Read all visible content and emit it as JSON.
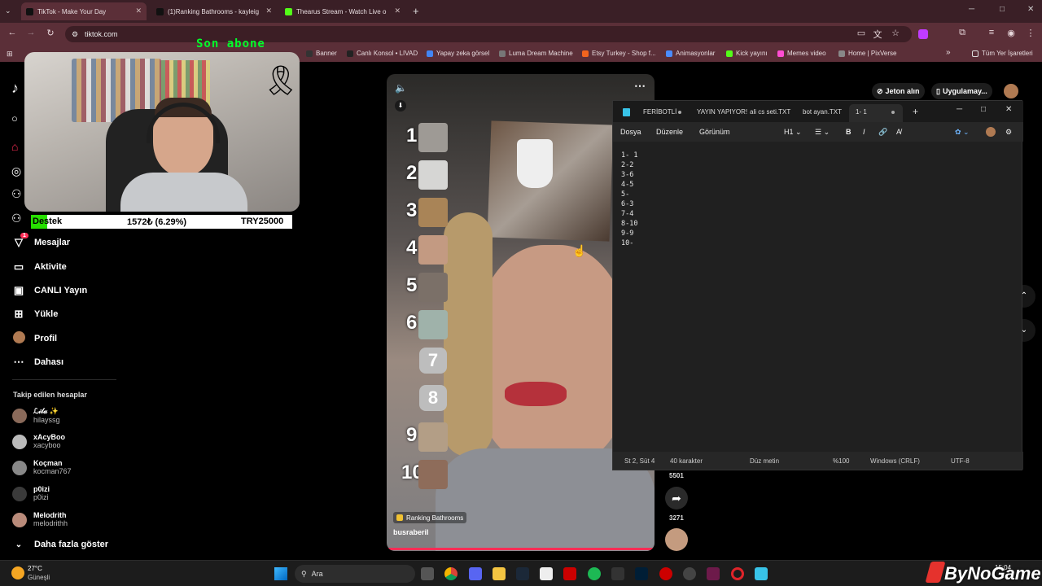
{
  "browser": {
    "tabs": [
      {
        "title": "TikTok - Make Your Day",
        "active": true
      },
      {
        "title": "(1)Ranking Bathrooms - kayleig",
        "active": false
      },
      {
        "title": "Thearus Stream - Watch Live o",
        "active": false
      }
    ],
    "new_tab": "+",
    "url": "tiktok.com",
    "bookmarks": [
      "Banner",
      "Canlı Konsol • LIVAD",
      "Yapay zeka görsel",
      "Luma Dream Machine",
      "Etsy Turkey - Shop f...",
      "Animasyonlar",
      "Kick yayını",
      "Memes video",
      "Home | PixVerse"
    ],
    "bookmarks_more": "»",
    "all_bookmarks": "Tüm Yer İşaretleri"
  },
  "stream_overlay": {
    "subscribe_text": "Son abone",
    "donation_label": "Destek",
    "donation_progress_text": "1572₺ (6.29%)",
    "donation_progress": 0.0629,
    "donation_goal": "TRY25000"
  },
  "tiktok": {
    "sidebar": {
      "items": [
        {
          "label": "Mesajlar",
          "icon": "send-icon",
          "badge": "1"
        },
        {
          "label": "Aktivite",
          "icon": "message-icon"
        },
        {
          "label": "CANLI Yayın",
          "icon": "live-icon"
        },
        {
          "label": "Yükle",
          "icon": "upload-icon"
        },
        {
          "label": "Profil",
          "icon": "avatar-icon"
        },
        {
          "label": "Dahası",
          "icon": "more-icon"
        }
      ],
      "following_title": "Takip edilen hesaplar",
      "following": [
        {
          "name": "ℒ𝒾𝓁𝒶 ✨",
          "handle": "hilayssg",
          "color": "#8a6a5a"
        },
        {
          "name": "xAcyBoo",
          "handle": "xacyboo",
          "color": "#bbbbbb"
        },
        {
          "name": "Koçman",
          "handle": "kocman767",
          "color": "#888888"
        },
        {
          "name": "p0izi",
          "handle": "p0izi",
          "color": "#3a3a3a"
        },
        {
          "name": "Melodrith",
          "handle": "melodrithh",
          "color": "#b98b7a"
        }
      ],
      "show_more": "Daha fazla göster"
    },
    "header": {
      "coins": "Jeton alın",
      "app": "Uygulamay..."
    },
    "video": {
      "ranks": [
        "1",
        "2",
        "3",
        "4",
        "5",
        "6",
        "7",
        "8",
        "9",
        "10"
      ],
      "effect_label": "Ranking Bathrooms",
      "author": "busraberil"
    },
    "actions": {
      "likes_count": "5501",
      "share_count": "3271"
    }
  },
  "notepad": {
    "tabs": [
      "FERİBOTLİ",
      "YAYIN YAPIYOR!",
      "ali cs seti.TXT",
      "bot ayan.TXT",
      "1- 1"
    ],
    "menu": [
      "Dosya",
      "Düzenle",
      "Görünüm"
    ],
    "heading_selector": "H1",
    "content": "1- 1\n2-2\n3-6\n4-5\n5-\n6-3\n7-4\n8-10\n9-9\n10-",
    "status": {
      "position": "St 2, Süt 4",
      "chars": "40 karakter",
      "format": "Düz metin",
      "zoom": "%100",
      "eol": "Windows (CRLF)",
      "encoding": "UTF-8"
    }
  },
  "taskbar": {
    "weather_temp": "27°C",
    "weather_desc": "Güneşli",
    "search_placeholder": "Ara",
    "time": "15:04"
  },
  "watermark": "ByNoGame"
}
